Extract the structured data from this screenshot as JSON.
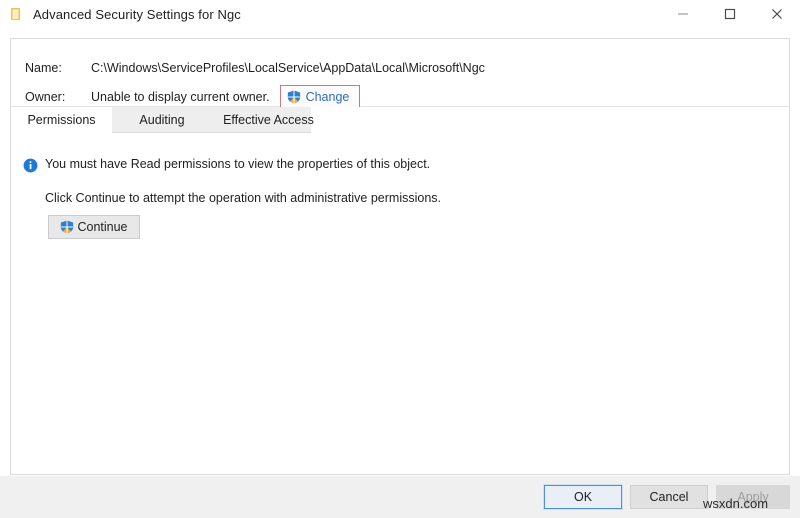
{
  "window": {
    "title": "Advanced Security Settings for Ngc",
    "icon": "folder-icon",
    "controls": {
      "minimize": "minimize-icon",
      "maximize": "maximize-icon",
      "close": "close-icon"
    }
  },
  "header": {
    "name_label": "Name:",
    "name_value": "C:\\Windows\\ServiceProfiles\\LocalService\\AppData\\Local\\Microsoft\\Ngc",
    "owner_label": "Owner:",
    "owner_value": "Unable to display current owner.",
    "change_link": "Change",
    "change_icon": "uac-shield-icon",
    "highlight_color": "#c9797f"
  },
  "tabs": [
    {
      "label": "Permissions",
      "selected": true
    },
    {
      "label": "Auditing",
      "selected": false
    },
    {
      "label": "Effective Access",
      "selected": false
    }
  ],
  "body": {
    "info_icon": "info-icon",
    "notice": "You must have Read permissions to view the properties of this object.",
    "subnote": "Click Continue to attempt the operation with administrative permissions.",
    "continue_label": "Continue",
    "continue_icon": "uac-shield-icon"
  },
  "footer": {
    "ok_label": "OK",
    "cancel_label": "Cancel",
    "apply_label": "Apply",
    "apply_disabled": true
  },
  "watermark": "wsxdn.com",
  "colors": {
    "link": "#2a6fb8",
    "info_blue": "#1e7ad4",
    "footer_bg": "#f0f0f0",
    "tab_bg": "#eeeeee"
  }
}
